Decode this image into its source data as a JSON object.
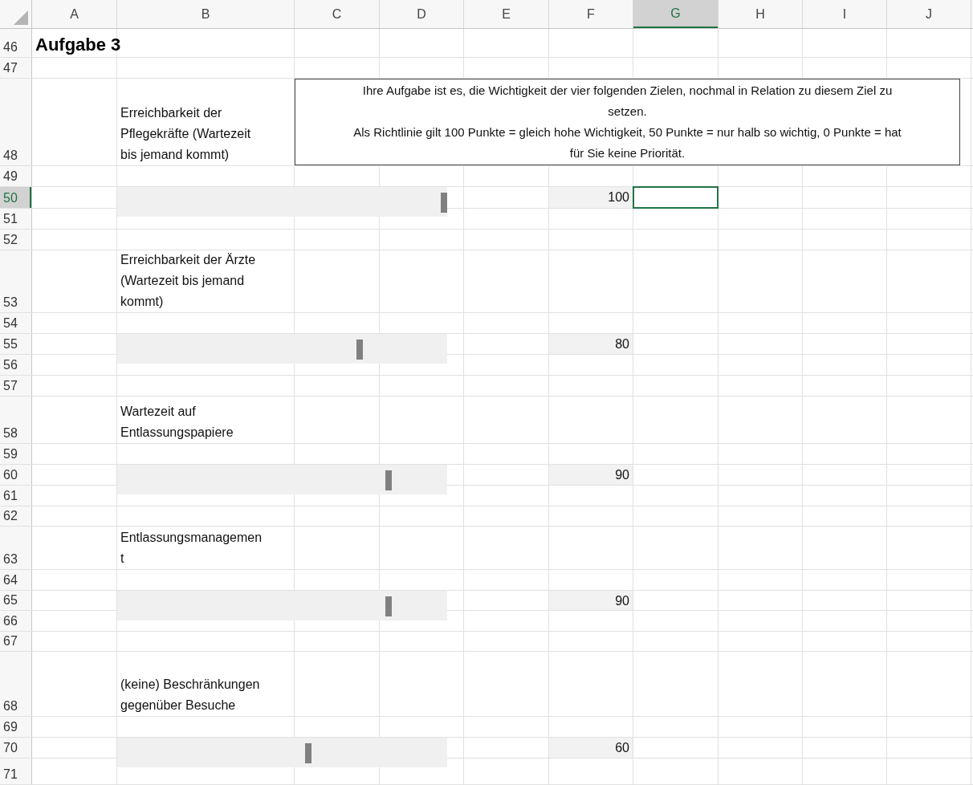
{
  "columns": [
    {
      "label": "A",
      "selected": false
    },
    {
      "label": "B",
      "selected": false
    },
    {
      "label": "C",
      "selected": false
    },
    {
      "label": "D",
      "selected": false
    },
    {
      "label": "E",
      "selected": false
    },
    {
      "label": "F",
      "selected": false
    },
    {
      "label": "G",
      "selected": true
    },
    {
      "label": "H",
      "selected": false
    },
    {
      "label": "I",
      "selected": false
    },
    {
      "label": "J",
      "selected": false
    }
  ],
  "rows": [
    {
      "number": "46",
      "selected": false,
      "cells": [
        {
          "kind": "title",
          "lines": [
            "Aufgabe 3"
          ]
        }
      ]
    },
    {
      "number": "47",
      "selected": false,
      "cells": []
    },
    {
      "number": "48",
      "selected": false,
      "cells": [
        {
          "kind": "label",
          "lines": [
            "Erreichbarkeit der",
            "Pflegekräfte (Wartezeit",
            "bis jemand kommt)"
          ]
        }
      ]
    },
    {
      "number": "49",
      "selected": false,
      "cells": []
    },
    {
      "number": "50",
      "selected": true,
      "slider": {
        "level": 1
      },
      "cells": [
        {
          "kind": "value",
          "lines": [
            "100"
          ]
        }
      ]
    },
    {
      "number": "51",
      "selected": false,
      "cells": []
    },
    {
      "number": "52",
      "selected": false,
      "cells": []
    },
    {
      "number": "53",
      "selected": false,
      "cells": [
        {
          "kind": "label",
          "lines": [
            "Erreichbarkeit der Ärzte",
            "(Wartezeit bis jemand",
            "kommt)"
          ]
        }
      ]
    },
    {
      "number": "54",
      "selected": false,
      "cells": []
    },
    {
      "number": "55",
      "selected": false,
      "slider": {
        "level": 0.74
      },
      "cells": [
        {
          "kind": "value",
          "lines": [
            "80"
          ]
        }
      ]
    },
    {
      "number": "56",
      "selected": false,
      "cells": []
    },
    {
      "number": "57",
      "selected": false,
      "cells": []
    },
    {
      "number": "58",
      "selected": false,
      "cells": [
        {
          "kind": "label",
          "lines": [
            "Wartezeit auf",
            "Entlassungspapiere"
          ]
        }
      ]
    },
    {
      "number": "59",
      "selected": false,
      "cells": []
    },
    {
      "number": "60",
      "selected": false,
      "slider": {
        "level": 0.83
      },
      "cells": [
        {
          "kind": "value",
          "lines": [
            "90"
          ]
        }
      ]
    },
    {
      "number": "61",
      "selected": false,
      "cells": []
    },
    {
      "number": "62",
      "selected": false,
      "cells": []
    },
    {
      "number": "63",
      "selected": false,
      "cells": [
        {
          "kind": "label",
          "lines": [
            "Entlassungsmanagemen",
            "t"
          ]
        }
      ]
    },
    {
      "number": "64",
      "selected": false,
      "cells": []
    },
    {
      "number": "65",
      "selected": false,
      "slider": {
        "level": 0.83
      },
      "cells": [
        {
          "kind": "value",
          "lines": [
            "90"
          ]
        }
      ]
    },
    {
      "number": "66",
      "selected": false,
      "cells": []
    },
    {
      "number": "67",
      "selected": false,
      "cells": []
    },
    {
      "number": "68",
      "selected": false,
      "cells": [
        {
          "kind": "label",
          "lines": [
            "(keine) Beschränkungen",
            "gegenüber Besuche"
          ]
        }
      ]
    },
    {
      "number": "69",
      "selected": false,
      "cells": []
    },
    {
      "number": "70",
      "selected": false,
      "slider": {
        "level": 0.58
      },
      "cells": [
        {
          "kind": "value",
          "lines": [
            "60"
          ]
        }
      ]
    },
    {
      "number": "71",
      "selected": false,
      "cells": []
    }
  ],
  "text_box": {
    "lines": [
      "Ihre Aufgabe ist es, die Wichtigkeit der vier folgenden Zielen, nochmal in Relation zu diesem Ziel zu",
      "setzen.",
      "Als Richtlinie gilt 100 Punkte = gleich hohe Wichtigkeit, 50 Punkte = nur halb so wichtig, 0 Punkte = hat",
      "für Sie keine Priorität."
    ]
  }
}
